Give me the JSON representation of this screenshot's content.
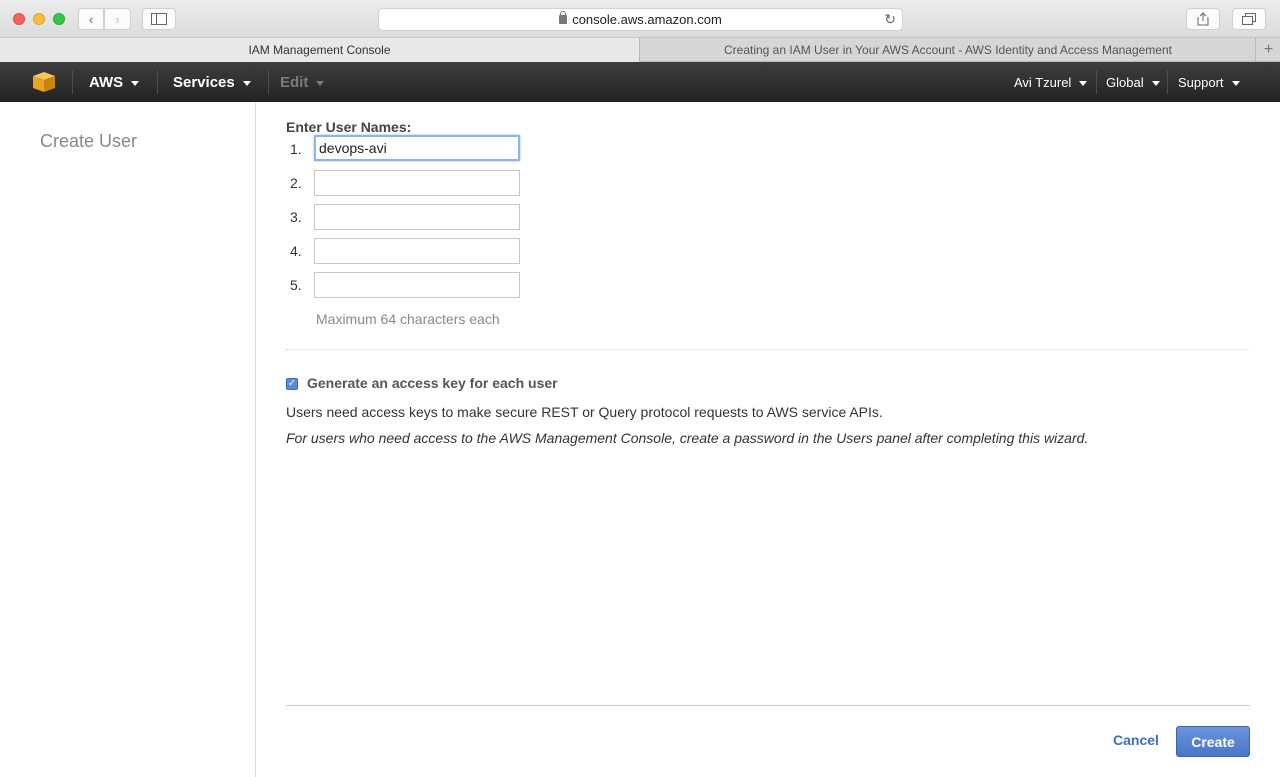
{
  "browser": {
    "url": "console.aws.amazon.com",
    "tabs": [
      {
        "label": "IAM Management Console"
      },
      {
        "label": "Creating an IAM User in Your AWS Account - AWS Identity and Access Management"
      }
    ]
  },
  "nav": {
    "aws": "AWS",
    "services": "Services",
    "edit": "Edit",
    "user": "Avi Tzurel",
    "region": "Global",
    "support": "Support"
  },
  "sidebar": {
    "title": "Create User"
  },
  "form": {
    "label": "Enter User Names:",
    "rows": [
      {
        "num": "1.",
        "value": ""
      },
      {
        "num": "2.",
        "value": ""
      },
      {
        "num": "3.",
        "value": ""
      },
      {
        "num": "4.",
        "value": ""
      },
      {
        "num": "5.",
        "value": ""
      }
    ],
    "first_value": "devops-avi",
    "hint": "Maximum 64 characters each",
    "checkbox_label": "Generate an access key for each user",
    "description": "Users need access keys to make secure REST or Query protocol requests to AWS service APIs.",
    "note": "For users who need access to the AWS Management Console, create a password in the Users panel after completing this wizard."
  },
  "actions": {
    "cancel": "Cancel",
    "create": "Create"
  },
  "colors": {
    "primary_button": "#4a74c7",
    "link": "#3a6ec1",
    "nav_bg": "#222222"
  }
}
